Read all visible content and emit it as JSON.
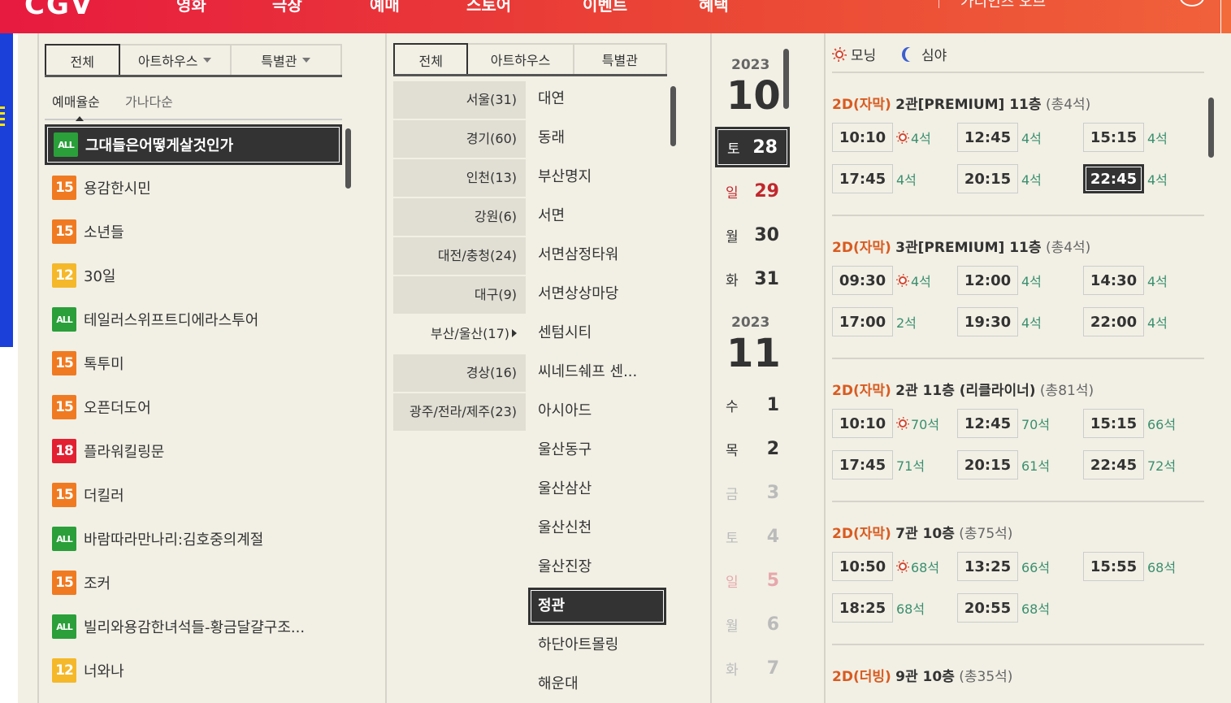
{
  "header": {
    "logo": "CGV",
    "nav": [
      "영화",
      "극장",
      "예매",
      "스토어",
      "이벤트",
      "혜택"
    ],
    "search_placeholder": "가디언즈 오브"
  },
  "movie_panel": {
    "tabs": [
      "전체",
      "아트하우스",
      "특별관"
    ],
    "sort_options": [
      "예매율순",
      "가나다순"
    ],
    "movies": [
      {
        "rating": "ALL",
        "title": "그대들은어떻게살것인가",
        "selected": true
      },
      {
        "rating": "15",
        "title": "용감한시민"
      },
      {
        "rating": "15",
        "title": "소년들"
      },
      {
        "rating": "12",
        "title": "30일"
      },
      {
        "rating": "ALL",
        "title": "테일러스위프트디에라스투어"
      },
      {
        "rating": "15",
        "title": "톡투미"
      },
      {
        "rating": "15",
        "title": "오픈더도어"
      },
      {
        "rating": "18",
        "title": "플라워킬링문"
      },
      {
        "rating": "15",
        "title": "더킬러"
      },
      {
        "rating": "ALL",
        "title": "바람따라만나리:김호중의계절"
      },
      {
        "rating": "15",
        "title": "조커"
      },
      {
        "rating": "ALL",
        "title": "빌리와용감한녀석들-황금달걀구조..."
      },
      {
        "rating": "12",
        "title": "너와나"
      }
    ]
  },
  "theater_panel": {
    "tabs": [
      "전체",
      "아트하우스",
      "특별관"
    ],
    "regions": [
      "서울(31)",
      "경기(60)",
      "인천(13)",
      "강원(6)",
      "대전/충청(24)",
      "대구(9)",
      "부산/울산(17)",
      "경상(16)",
      "광주/전라/제주(23)"
    ],
    "theaters": [
      "대연",
      "동래",
      "부산명지",
      "서면",
      "서면삼정타워",
      "서면상상마당",
      "센텀시티",
      "씨네드쉐프 센...",
      "아시아드",
      "울산동구",
      "울산삼산",
      "울산신천",
      "울산진장",
      "정관",
      "하단아트몰링",
      "해운대"
    ]
  },
  "date_panel": {
    "groups": [
      {
        "year": "2023",
        "month": "10",
        "days": [
          {
            "dow": "토",
            "day": "28",
            "state": "selected"
          },
          {
            "dow": "일",
            "day": "29",
            "state": "sun"
          },
          {
            "dow": "월",
            "day": "30",
            "state": "normal"
          },
          {
            "dow": "화",
            "day": "31",
            "state": "normal"
          }
        ]
      },
      {
        "year": "2023",
        "month": "11",
        "days": [
          {
            "dow": "수",
            "day": "1",
            "state": "normal"
          },
          {
            "dow": "목",
            "day": "2",
            "state": "normal"
          },
          {
            "dow": "금",
            "day": "3",
            "state": "dim"
          },
          {
            "dow": "토",
            "day": "4",
            "state": "dim"
          },
          {
            "dow": "일",
            "day": "5",
            "state": "dim-sun"
          },
          {
            "dow": "월",
            "day": "6",
            "state": "dim"
          },
          {
            "dow": "화",
            "day": "7",
            "state": "dim"
          }
        ]
      }
    ]
  },
  "time_panel": {
    "legend": {
      "morning": "모닝",
      "night": "심야"
    },
    "halls": [
      {
        "format": "2D(자막)",
        "hall": "2관[PREMIUM] 11층",
        "total": "(총4석)",
        "slots": [
          {
            "time": "10:10",
            "seats": "4석",
            "morning": true
          },
          {
            "time": "12:45",
            "seats": "4석"
          },
          {
            "time": "15:15",
            "seats": "4석"
          },
          {
            "time": "17:45",
            "seats": "4석"
          },
          {
            "time": "20:15",
            "seats": "4석"
          },
          {
            "time": "22:45",
            "seats": "4석",
            "selected": true
          }
        ]
      },
      {
        "format": "2D(자막)",
        "hall": "3관[PREMIUM] 11층",
        "total": "(총4석)",
        "slots": [
          {
            "time": "09:30",
            "seats": "4석",
            "morning": true
          },
          {
            "time": "12:00",
            "seats": "4석"
          },
          {
            "time": "14:30",
            "seats": "4석"
          },
          {
            "time": "17:00",
            "seats": "2석"
          },
          {
            "time": "19:30",
            "seats": "4석"
          },
          {
            "time": "22:00",
            "seats": "4석"
          }
        ]
      },
      {
        "format": "2D(자막)",
        "hall": "2관 11층 (리클라이너)",
        "total": "(총81석)",
        "slots": [
          {
            "time": "10:10",
            "seats": "70석",
            "morning": true
          },
          {
            "time": "12:45",
            "seats": "70석"
          },
          {
            "time": "15:15",
            "seats": "66석"
          },
          {
            "time": "17:45",
            "seats": "71석"
          },
          {
            "time": "20:15",
            "seats": "61석"
          },
          {
            "time": "22:45",
            "seats": "72석"
          }
        ]
      },
      {
        "format": "2D(자막)",
        "hall": "7관 10층",
        "total": "(총75석)",
        "slots": [
          {
            "time": "10:50",
            "seats": "68석",
            "morning": true
          },
          {
            "time": "13:25",
            "seats": "66석"
          },
          {
            "time": "15:55",
            "seats": "68석"
          },
          {
            "time": "18:25",
            "seats": "68석"
          },
          {
            "time": "20:55",
            "seats": "68석"
          }
        ]
      },
      {
        "format": "2D(더빙)",
        "hall": "9관 10층",
        "total": "(총35석)",
        "slots": []
      }
    ]
  },
  "colors": {
    "header_start": "#e71a3f",
    "header_end": "#f0613a",
    "panel_bg": "#f2f0e5",
    "format_orange": "#d95b20",
    "seat_green": "#3a8f6e",
    "sunday_red": "#c0272d"
  }
}
